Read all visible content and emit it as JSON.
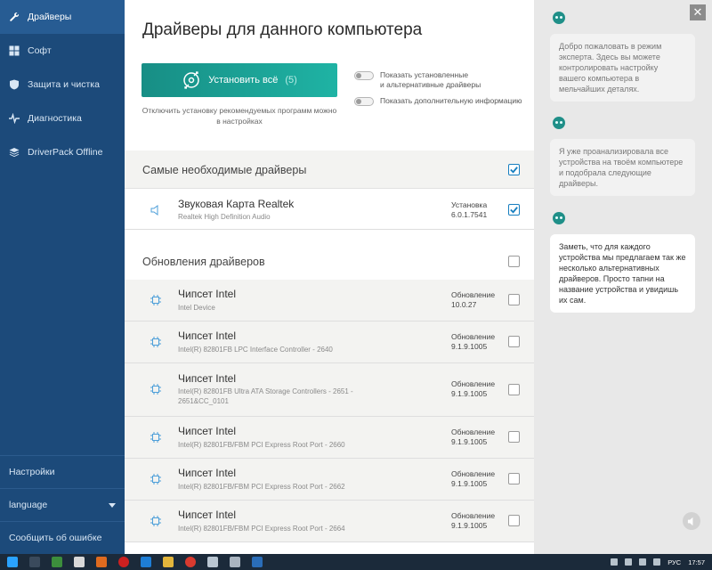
{
  "sidebar": {
    "items": [
      {
        "label": "Драйверы",
        "icon": "wrench-icon"
      },
      {
        "label": "Софт",
        "icon": "grid-icon"
      },
      {
        "label": "Защита и чистка",
        "icon": "shield-icon"
      },
      {
        "label": "Диагностика",
        "icon": "pulse-icon"
      },
      {
        "label": "DriverPack Offline",
        "icon": "layers-icon"
      }
    ],
    "settings": "Настройки",
    "language": "language",
    "report_bug": "Сообщить об ошибке"
  },
  "main": {
    "title": "Драйверы для данного компьютера",
    "install_all": {
      "label": "Установить всё",
      "count": "(5)"
    },
    "install_note": "Отключить установку рекомендуемых программ можно в настройках",
    "toggles": [
      {
        "label_line1": "Показать установленные",
        "label_line2": "и альтернативные драйверы"
      },
      {
        "label_line1": "Показать дополнительную информацию",
        "label_line2": ""
      }
    ],
    "essential": {
      "title": "Самые необходимые драйверы",
      "checked": true,
      "items": [
        {
          "name": "Звуковая Карта Realtek",
          "sub": "Realtek High Definition Audio",
          "action": "Установка",
          "version": "6.0.1.7541",
          "checked": true
        }
      ]
    },
    "updates": {
      "title": "Обновления драйверов",
      "checked": false,
      "items": [
        {
          "name": "Чипсет Intel",
          "sub": "Intel Device",
          "action": "Обновление",
          "version": "10.0.27",
          "checked": false
        },
        {
          "name": "Чипсет Intel",
          "sub": "Intel(R) 82801FB LPC Interface Controller - 2640",
          "action": "Обновление",
          "version": "9.1.9.1005",
          "checked": false
        },
        {
          "name": "Чипсет Intel",
          "sub": "Intel(R) 82801FB Ultra ATA Storage Controllers - 2651 - 2651&CC_0101",
          "action": "Обновление",
          "version": "9.1.9.1005",
          "checked": false
        },
        {
          "name": "Чипсет Intel",
          "sub": "Intel(R) 82801FB/FBM PCI Express Root Port - 2660",
          "action": "Обновление",
          "version": "9.1.9.1005",
          "checked": false
        },
        {
          "name": "Чипсет Intel",
          "sub": "Intel(R) 82801FB/FBM PCI Express Root Port - 2662",
          "action": "Обновление",
          "version": "9.1.9.1005",
          "checked": false
        },
        {
          "name": "Чипсет Intel",
          "sub": "Intel(R) 82801FB/FBM PCI Express Root Port - 2664",
          "action": "Обновление",
          "version": "9.1.9.1005",
          "checked": false
        }
      ]
    }
  },
  "assistant": {
    "messages": [
      "Добро пожаловать в режим эксперта. Здесь вы можете контролировать настройку вашего компьютера в мельчайших деталях.",
      "Я уже проанализировала все устройства на твоём компьютере и подобрала следующие драйверы.",
      "Заметь, что для каждого устройства мы предлагаем так же несколько альтернативных драйверов. Просто тапни на название устройства и увидишь их сам."
    ],
    "close": "✕"
  },
  "taskbar": {
    "lang": "РУС",
    "time": "17:57"
  },
  "colors": {
    "sidebar": "#1c4a7a",
    "sidebar_active": "#275c93",
    "accent": "#1fb3a4",
    "checkbox": "#177fc0"
  }
}
